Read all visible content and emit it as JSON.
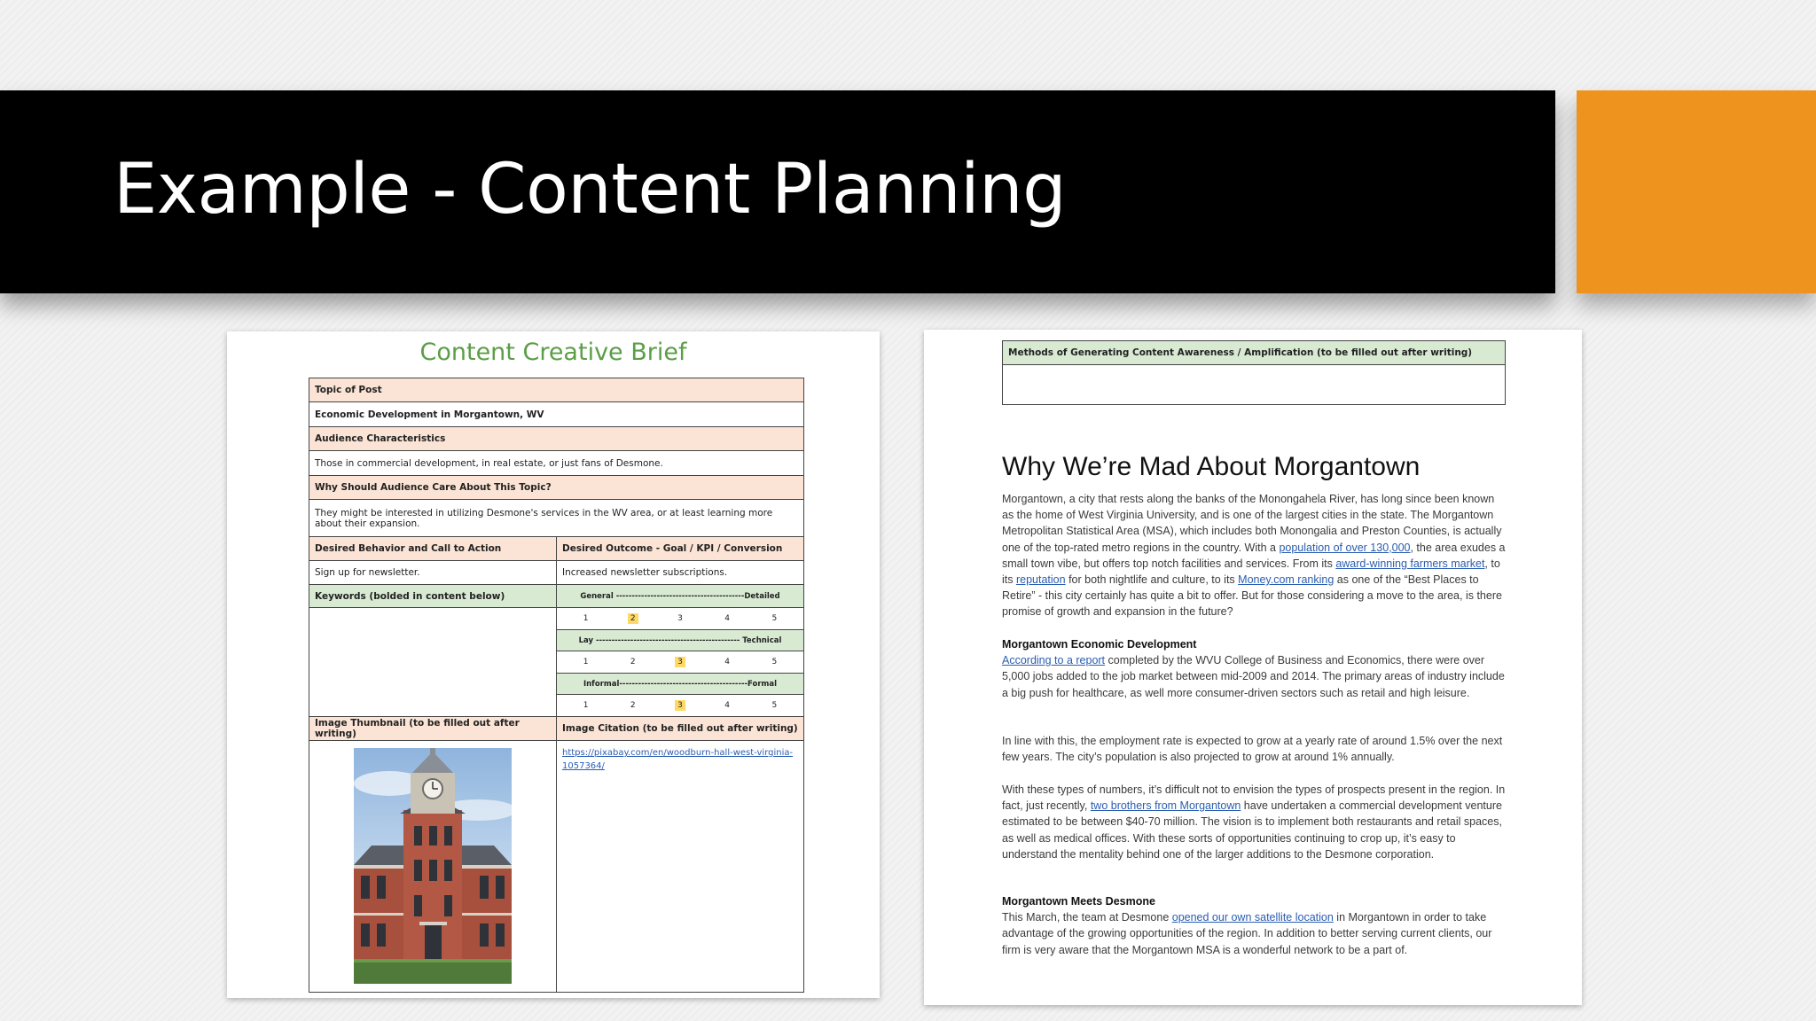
{
  "slide": {
    "title": "Example - Content Planning",
    "accent_color": "#ee931d"
  },
  "brief": {
    "title": "Content Creative Brief",
    "topic_header": "Topic of Post",
    "topic_value": "Economic Development in Morgantown, WV",
    "audience_header": "Audience Characteristics",
    "audience_value": "Those in commercial development, in real estate, or just fans of Desmone.",
    "why_header": "Why Should Audience Care About This Topic?",
    "why_value": "They might be interested in utilizing Desmone's services in the WV area, or at least learning more about their expansion.",
    "behavior_header": "Desired Behavior and Call to Action",
    "outcome_header": "Desired Outcome - Goal / KPI / Conversion",
    "behavior_value": "Sign up for newsletter.",
    "outcome_value": "Increased newsletter subscriptions.",
    "keywords_header": "Keywords (bolded in content below)",
    "scale1_label": "General -----------------------------------------Detailed",
    "scale2_label": "Lay ---------------------------------------------- Technical",
    "scale3_label": "Informal-----------------------------------------Formal",
    "scale_numbers": [
      "1",
      "2",
      "3",
      "4",
      "5"
    ],
    "scale1_selected": 2,
    "scale2_selected": 3,
    "scale3_selected": 3,
    "thumbnail_header": "Image Thumbnail (to be filled out after writing)",
    "citation_header": "Image Citation (to be filled out after writing)",
    "citation_link": "https://pixabay.com/en/woodburn-hall-west-virginia-1057364/"
  },
  "article": {
    "amplification_header": "Methods of Generating Content Awareness / Amplification (to be filled out after writing)",
    "title": "Why We’re Mad About Morgantown",
    "p1": {
      "a": "Morgantown, a city that rests along the banks of the Monongahela River, has long since been known as the home of West Virginia University, and is one of the largest cities in the state. The Morgantown Metropolitan Statistical Area (MSA), which includes both Monongalia and Preston Counties, is actually one of the top-rated metro regions in the country. With a ",
      "link1": "population of over 130,000",
      "b": ", the area exudes a small town vibe, but offers top notch facilities and services. From its ",
      "link2": "award-winning farmers market",
      "c": ", to its ",
      "link3": "reputation",
      "d": " for both nightlife and culture, to its ",
      "link4": "Money.com ranking",
      "e": " as one of the “Best Places to Retire” - this city certainly has quite a bit to offer. But for those considering a move to the area, is there promise of growth and expansion in the future?"
    },
    "h2": "Morgantown Economic Development",
    "p2": {
      "link": "According to a report",
      "a": " completed by the WVU College of Business and Economics, there were over 5,000 jobs added to the job market between mid-2009 and 2014. The primary areas of industry include a big push for healthcare, as well more consumer-driven sectors such as retail and high leisure."
    },
    "p3": "In line with this, the employment rate is expected to grow at a yearly rate of around 1.5% over the next few years. The city’s population is also projected to grow at around 1% annually.",
    "p4": {
      "a": "With these types of numbers, it’s difficult not to envision the types of prospects present in the region. In fact, just recently, ",
      "link": "two brothers from Morgantown",
      "b": " have undertaken a commercial development venture estimated to be between $40-70 million. The vision is to implement both restaurants and retail spaces, as well as medical offices. With these sorts of opportunities continuing to crop up, it’s easy to understand the mentality behind one of the larger additions to the Desmone corporation."
    },
    "h3": "Morgantown Meets Desmone",
    "p5": {
      "a": "This March, the team at Desmone ",
      "link": "opened our own satellite location",
      "b": " in Morgantown in order to take advantage of the growing opportunities of the region. In addition to better serving current clients, our firm is very aware that the Morgantown MSA is a wonderful network to be a part of."
    }
  }
}
